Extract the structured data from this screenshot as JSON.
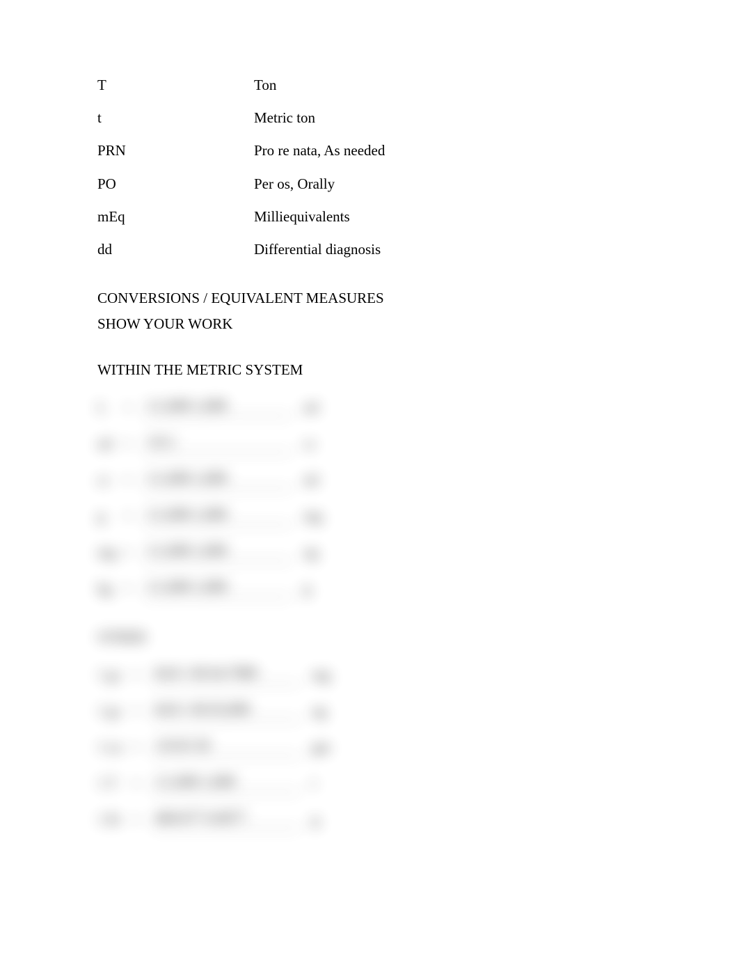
{
  "abbreviations": [
    {
      "abbr": "T",
      "meaning": "Ton"
    },
    {
      "abbr": "t",
      "meaning": "Metric ton"
    },
    {
      "abbr": "PRN",
      "meaning": "Pro re nata, As needed"
    },
    {
      "abbr": "PO",
      "meaning": "Per os, Orally"
    },
    {
      "abbr": "mEq",
      "meaning": "Milliequivalents"
    },
    {
      "abbr": "dd",
      "meaning": "Differential diagnosis"
    }
  ],
  "section": {
    "title": "CONVERSIONS    /   EQUIVALENT MEASURES",
    "subtitle": "SHOW YOUR WORK",
    "within_metric": "WITHIN THE METRIC SYSTEM",
    "other": "OTHER"
  },
  "conversions_metric": [
    {
      "left": "L",
      "eq": "=",
      "value": "1/1,000   1,000",
      "right": "ml"
    },
    {
      "left": "ml",
      "eq": "=",
      "value": "1/0.1",
      "right": "cc"
    },
    {
      "left": "cc",
      "eq": "=",
      "value": "1/1,000   1,000",
      "right": "ml"
    },
    {
      "left": "g",
      "eq": "=",
      "value": "1/1,000  1,000",
      "right": "mg"
    },
    {
      "left": "mg",
      "eq": "=",
      "value": "1/1,000  1,000",
      "right": "ug"
    },
    {
      "left": "kg",
      "eq": "=",
      "value": "1/1,000  1,000",
      "right": "g"
    }
  ],
  "conversions_other": [
    {
      "left": "1 gr",
      "eq": "=",
      "value": "64.8 / 60   64.7989",
      "right": "mg"
    },
    {
      "left": "1 gr",
      "eq": "=",
      "value": "64.8 / 60   65,000",
      "right": "ug"
    },
    {
      "left": "1 oz",
      "eq": "=",
      "value": "1/0.03  30",
      "right": "gm"
    },
    {
      "left": "1 T",
      "eq": "=",
      "value": "1/1,000 1,000",
      "right": "t"
    },
    {
      "left": "1 lb",
      "eq": "=",
      "value": "460/477  0.0077",
      "right": "g"
    }
  ]
}
